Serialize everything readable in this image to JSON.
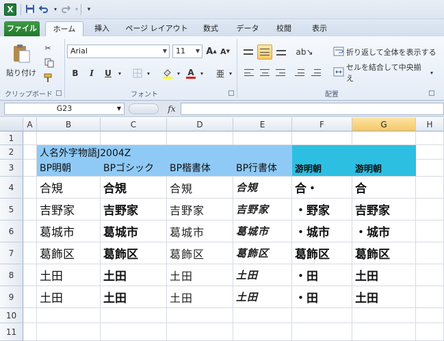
{
  "quick_access": {
    "app_icon": "X",
    "save_icon": "save-icon",
    "undo_icon": "undo-icon",
    "redo_icon": "redo-icon",
    "customize_icon": "customize-icon"
  },
  "tabs": [
    {
      "label": "ファイル"
    },
    {
      "label": "ホーム"
    },
    {
      "label": "挿入"
    },
    {
      "label": "ページ レイアウト"
    },
    {
      "label": "数式"
    },
    {
      "label": "データ"
    },
    {
      "label": "校閲"
    },
    {
      "label": "表示"
    }
  ],
  "ribbon": {
    "clipboard": {
      "paste_label": "貼り付け",
      "group_label": "クリップボード"
    },
    "font": {
      "font_name": "Arial",
      "font_size": "11",
      "grow": "A",
      "shrink": "A",
      "bold": "B",
      "italic": "I",
      "underline": "U",
      "group_label": "フォント"
    },
    "alignment": {
      "wrap_text": "折り返して全体を表示する",
      "merge_center": "セルを結合して中央揃え",
      "group_label": "配置"
    }
  },
  "formula_bar": {
    "name_box": "G23",
    "fx": "fx",
    "value": ""
  },
  "grid": {
    "columns": [
      "A",
      "B",
      "C",
      "D",
      "E",
      "F",
      "G",
      "H"
    ],
    "selected_column": "G",
    "rows": [
      "1",
      "2",
      "3",
      "4",
      "5",
      "6",
      "7",
      "8",
      "9",
      "10",
      "11"
    ],
    "title": "人名外字物語J2004Z",
    "headers": [
      "BP明朝",
      "BPゴシック",
      "BP楷書体",
      "BP行書体",
      "游明朝",
      "游明朝"
    ],
    "data": [
      [
        "合䂓",
        "合䂓",
        "合䂓",
        "合䂓",
        "合・",
        "合"
      ],
      [
        "吉野家",
        "吉野家",
        "吉野家",
        "吉野家",
        "・野家",
        "吉野家"
      ],
      [
        "葛城市",
        "葛城市",
        "葛城市",
        "葛城市",
        "・城市",
        "・城市"
      ],
      [
        "葛飾区",
        "葛飾区",
        "葛飾区",
        "葛飾区",
        "葛飾区",
        "葛飾区"
      ],
      [
        "土田",
        "土田",
        "土田",
        "土田",
        "・田",
        "土田"
      ],
      [
        "土田",
        "土田",
        "土田",
        "土田",
        "・田",
        "土田"
      ]
    ]
  },
  "colors": {
    "light_fill": "#8fcaf6",
    "teal_fill": "#2dbfe2",
    "file_tab": "#217a2a",
    "selected_header": "#f6c765"
  }
}
